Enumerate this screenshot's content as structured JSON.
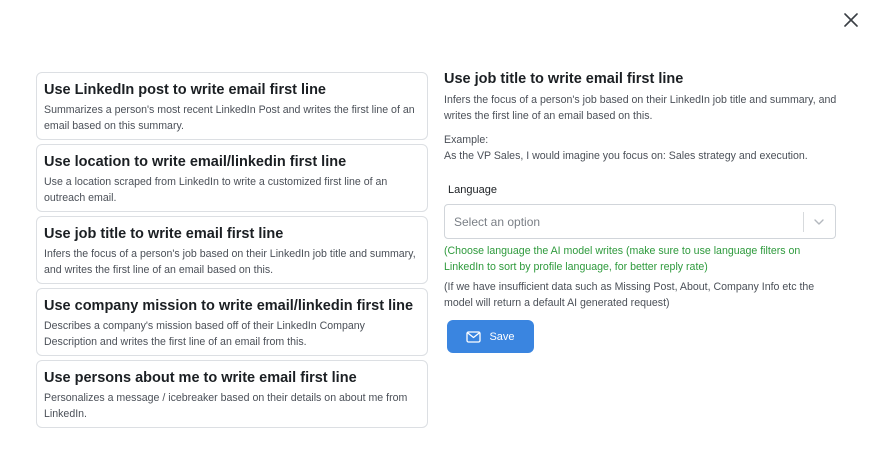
{
  "close": {
    "icon": "close-icon"
  },
  "options": [
    {
      "title": "Use LinkedIn post to write email first line",
      "description": "Summarizes a person's most recent LinkedIn Post and writes the first line of an email based on this summary."
    },
    {
      "title": "Use location to write email/linkedin first line",
      "description": "Use a location scraped from LinkedIn to write a customized first line of an outreach email."
    },
    {
      "title": "Use job title to write email first line",
      "description": "Infers the focus of a person's job based on their LinkedIn job title and summary, and writes the first line of an email based on this."
    },
    {
      "title": "Use company mission to write email/linkedin first line",
      "description": "Describes a company's mission based off of their LinkedIn Company Description and writes the first line of an email from this."
    },
    {
      "title": "Use persons about me to write email first line",
      "description": "Personalizes a message / icebreaker based on their details on about me from LinkedIn."
    }
  ],
  "detail": {
    "title": "Use job title to write email first line",
    "description": "Infers the focus of a person's job based on their LinkedIn job title and summary, and writes the first line of an email based on this.",
    "example_label": "Example:",
    "example_text": "As the VP Sales, I would imagine you focus on: Sales strategy and execution."
  },
  "language": {
    "label": "Language",
    "placeholder": "Select an option",
    "hint": "(Choose language the AI model writes (make sure to use language filters on LinkedIn to sort by profile language, for better reply rate)",
    "note": "(If we have insufficient data such as Missing Post, About, Company Info etc the model will return a default AI generated request)"
  },
  "save": {
    "label": "Save",
    "icon": "mail-icon"
  },
  "colors": {
    "accent": "#3a85e0",
    "hint_green": "#2e9a3c",
    "border": "#dcdfe3"
  }
}
